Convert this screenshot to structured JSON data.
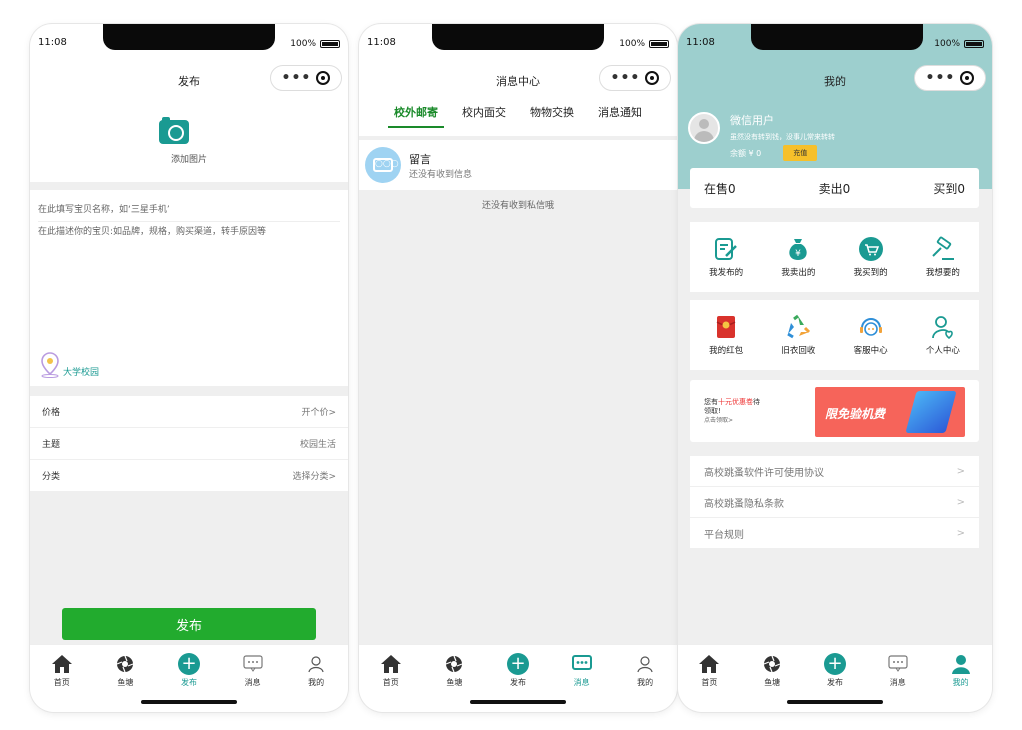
{
  "status": {
    "time": "11:08",
    "battery": "100%"
  },
  "tabbar": {
    "home": "首页",
    "pond": "鱼塘",
    "publish": "发布",
    "message": "消息",
    "mine": "我的"
  },
  "publish": {
    "title": "发布",
    "add_photo": "添加图片",
    "name_placeholder": "在此填写宝贝名称，如‘三星手机’",
    "desc_placeholder": "在此描述你的宝贝:如品牌，规格，购买渠道，转手原因等",
    "location": "大学校园",
    "rows": [
      {
        "label": "价格",
        "value": "开个价>"
      },
      {
        "label": "主题",
        "value": "校园生活"
      },
      {
        "label": "分类",
        "value": "选择分类>"
      }
    ],
    "submit": "发布"
  },
  "messages": {
    "title": "消息中心",
    "tabs": [
      "校外邮寄",
      "校内面交",
      "物物交换",
      "消息通知"
    ],
    "item_title": "留言",
    "item_sub": "还没有收到信息",
    "empty": "还没有收到私信哦",
    "bubble_dots": "○○○"
  },
  "mine": {
    "title": "我的",
    "user_name": "微信用户",
    "user_sub": "虽然没有转到钱，没事儿常来转转",
    "balance": "余额 ¥ 0",
    "recharge": "充值",
    "stats": [
      "在售0",
      "卖出0",
      "买到0"
    ],
    "grid1": [
      {
        "label": "我发布的",
        "icon": "edit-icon"
      },
      {
        "label": "我卖出的",
        "icon": "money-bag-icon"
      },
      {
        "label": "我买到的",
        "icon": "cart-icon"
      },
      {
        "label": "我想要的",
        "icon": "gavel-icon"
      }
    ],
    "grid2": [
      {
        "label": "我的红包",
        "icon": "red-packet-icon"
      },
      {
        "label": "旧衣回收",
        "icon": "recycle-icon"
      },
      {
        "label": "客服中心",
        "icon": "support-icon"
      },
      {
        "label": "个人中心",
        "icon": "person-icon"
      }
    ],
    "banner_pre": "您有",
    "banner_red": "十元优惠卷",
    "banner_post": "待领取!",
    "banner_small": "点击领取>",
    "banner_ad": "限免验机费",
    "links": [
      "高校跳蚤软件许可使用协议",
      "高校跳蚤隐私条款",
      "平台规则"
    ],
    "arrow": ">"
  },
  "colors": {
    "accent": "#1a9a92",
    "header_bg": "#9dcfce",
    "submit": "#22ab2e",
    "tab_active": "#1a8a2a"
  }
}
